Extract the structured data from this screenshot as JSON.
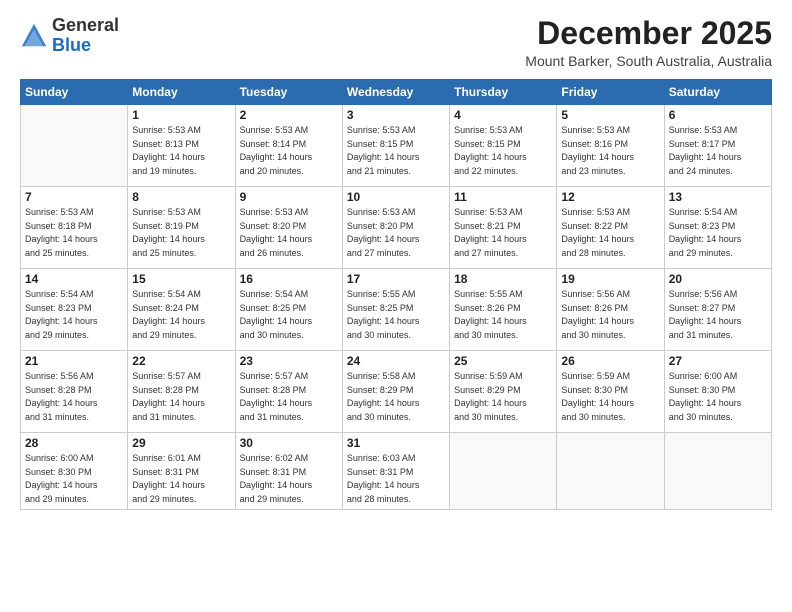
{
  "header": {
    "logo": {
      "line1": "General",
      "line2": "Blue"
    },
    "title": "December 2025",
    "location": "Mount Barker, South Australia, Australia"
  },
  "weekdays": [
    "Sunday",
    "Monday",
    "Tuesday",
    "Wednesday",
    "Thursday",
    "Friday",
    "Saturday"
  ],
  "weeks": [
    [
      {
        "day": "",
        "info": ""
      },
      {
        "day": "1",
        "info": "Sunrise: 5:53 AM\nSunset: 8:13 PM\nDaylight: 14 hours\nand 19 minutes."
      },
      {
        "day": "2",
        "info": "Sunrise: 5:53 AM\nSunset: 8:14 PM\nDaylight: 14 hours\nand 20 minutes."
      },
      {
        "day": "3",
        "info": "Sunrise: 5:53 AM\nSunset: 8:15 PM\nDaylight: 14 hours\nand 21 minutes."
      },
      {
        "day": "4",
        "info": "Sunrise: 5:53 AM\nSunset: 8:15 PM\nDaylight: 14 hours\nand 22 minutes."
      },
      {
        "day": "5",
        "info": "Sunrise: 5:53 AM\nSunset: 8:16 PM\nDaylight: 14 hours\nand 23 minutes."
      },
      {
        "day": "6",
        "info": "Sunrise: 5:53 AM\nSunset: 8:17 PM\nDaylight: 14 hours\nand 24 minutes."
      }
    ],
    [
      {
        "day": "7",
        "info": "Sunrise: 5:53 AM\nSunset: 8:18 PM\nDaylight: 14 hours\nand 25 minutes."
      },
      {
        "day": "8",
        "info": "Sunrise: 5:53 AM\nSunset: 8:19 PM\nDaylight: 14 hours\nand 25 minutes."
      },
      {
        "day": "9",
        "info": "Sunrise: 5:53 AM\nSunset: 8:20 PM\nDaylight: 14 hours\nand 26 minutes."
      },
      {
        "day": "10",
        "info": "Sunrise: 5:53 AM\nSunset: 8:20 PM\nDaylight: 14 hours\nand 27 minutes."
      },
      {
        "day": "11",
        "info": "Sunrise: 5:53 AM\nSunset: 8:21 PM\nDaylight: 14 hours\nand 27 minutes."
      },
      {
        "day": "12",
        "info": "Sunrise: 5:53 AM\nSunset: 8:22 PM\nDaylight: 14 hours\nand 28 minutes."
      },
      {
        "day": "13",
        "info": "Sunrise: 5:54 AM\nSunset: 8:23 PM\nDaylight: 14 hours\nand 29 minutes."
      }
    ],
    [
      {
        "day": "14",
        "info": "Sunrise: 5:54 AM\nSunset: 8:23 PM\nDaylight: 14 hours\nand 29 minutes."
      },
      {
        "day": "15",
        "info": "Sunrise: 5:54 AM\nSunset: 8:24 PM\nDaylight: 14 hours\nand 29 minutes."
      },
      {
        "day": "16",
        "info": "Sunrise: 5:54 AM\nSunset: 8:25 PM\nDaylight: 14 hours\nand 30 minutes."
      },
      {
        "day": "17",
        "info": "Sunrise: 5:55 AM\nSunset: 8:25 PM\nDaylight: 14 hours\nand 30 minutes."
      },
      {
        "day": "18",
        "info": "Sunrise: 5:55 AM\nSunset: 8:26 PM\nDaylight: 14 hours\nand 30 minutes."
      },
      {
        "day": "19",
        "info": "Sunrise: 5:56 AM\nSunset: 8:26 PM\nDaylight: 14 hours\nand 30 minutes."
      },
      {
        "day": "20",
        "info": "Sunrise: 5:56 AM\nSunset: 8:27 PM\nDaylight: 14 hours\nand 31 minutes."
      }
    ],
    [
      {
        "day": "21",
        "info": "Sunrise: 5:56 AM\nSunset: 8:28 PM\nDaylight: 14 hours\nand 31 minutes."
      },
      {
        "day": "22",
        "info": "Sunrise: 5:57 AM\nSunset: 8:28 PM\nDaylight: 14 hours\nand 31 minutes."
      },
      {
        "day": "23",
        "info": "Sunrise: 5:57 AM\nSunset: 8:28 PM\nDaylight: 14 hours\nand 31 minutes."
      },
      {
        "day": "24",
        "info": "Sunrise: 5:58 AM\nSunset: 8:29 PM\nDaylight: 14 hours\nand 30 minutes."
      },
      {
        "day": "25",
        "info": "Sunrise: 5:59 AM\nSunset: 8:29 PM\nDaylight: 14 hours\nand 30 minutes."
      },
      {
        "day": "26",
        "info": "Sunrise: 5:59 AM\nSunset: 8:30 PM\nDaylight: 14 hours\nand 30 minutes."
      },
      {
        "day": "27",
        "info": "Sunrise: 6:00 AM\nSunset: 8:30 PM\nDaylight: 14 hours\nand 30 minutes."
      }
    ],
    [
      {
        "day": "28",
        "info": "Sunrise: 6:00 AM\nSunset: 8:30 PM\nDaylight: 14 hours\nand 29 minutes."
      },
      {
        "day": "29",
        "info": "Sunrise: 6:01 AM\nSunset: 8:31 PM\nDaylight: 14 hours\nand 29 minutes."
      },
      {
        "day": "30",
        "info": "Sunrise: 6:02 AM\nSunset: 8:31 PM\nDaylight: 14 hours\nand 29 minutes."
      },
      {
        "day": "31",
        "info": "Sunrise: 6:03 AM\nSunset: 8:31 PM\nDaylight: 14 hours\nand 28 minutes."
      },
      {
        "day": "",
        "info": ""
      },
      {
        "day": "",
        "info": ""
      },
      {
        "day": "",
        "info": ""
      }
    ]
  ]
}
